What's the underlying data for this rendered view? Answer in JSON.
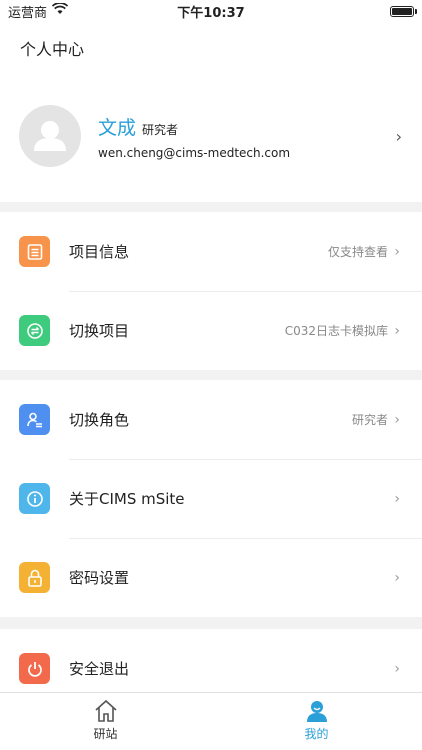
{
  "status": {
    "carrier": "运营商",
    "time": "下午10:37"
  },
  "header": {
    "title": "个人中心"
  },
  "profile": {
    "name": "文成",
    "role": "研究者",
    "email": "wen.cheng@cims-medtech.com"
  },
  "menu": {
    "project_info": {
      "label": "项目信息",
      "value": "仅支持查看",
      "color": "#f7934a"
    },
    "switch_project": {
      "label": "切换项目",
      "value": "C032日志卡模拟库",
      "color": "#3ecb7e"
    },
    "switch_role": {
      "label": "切换角色",
      "value": "研究者",
      "color": "#4e8ff0"
    },
    "about": {
      "label": "关于CIMS mSite",
      "color": "#4fb6ec"
    },
    "password": {
      "label": "密码设置",
      "color": "#f5b133"
    },
    "logout": {
      "label": "安全退出",
      "color": "#f26a4b"
    }
  },
  "tabs": {
    "home": "研站",
    "mine": "我的"
  },
  "colors": {
    "accent": "#2a9fd8"
  }
}
